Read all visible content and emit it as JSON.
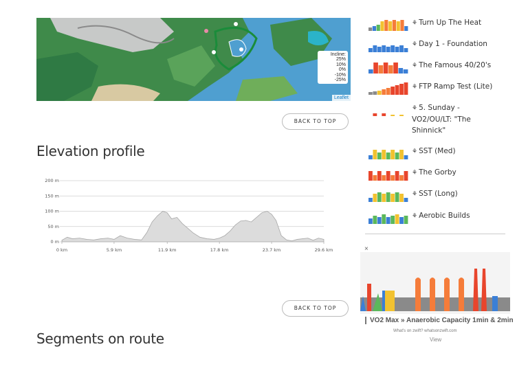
{
  "map": {
    "legend_title": "Incline:",
    "legend_values": [
      "25%",
      "10%",
      "0%",
      "-10%",
      "-25%"
    ],
    "attribution": "Leaflet"
  },
  "buttons": {
    "back_to_top": "BACK TO TOP"
  },
  "elevation": {
    "heading": "Elevation profile",
    "chart_data": {
      "type": "area",
      "x_unit": "km",
      "y_unit": "m",
      "x_ticks": [
        "0 km",
        "5.9 km",
        "11.9 km",
        "17.8 km",
        "23.7 km",
        "29.6 km"
      ],
      "y_ticks": [
        "200 m",
        "150 m",
        "100 m",
        "50 m",
        "0 m"
      ],
      "xlim": [
        0,
        29.6
      ],
      "ylim": [
        0,
        200
      ],
      "grid": true,
      "x": [
        0,
        0.6,
        1.2,
        2,
        2.8,
        3.6,
        4.4,
        5.2,
        5.9,
        6.6,
        7.4,
        8.2,
        9,
        9.6,
        10.2,
        10.8,
        11.4,
        11.9,
        12.4,
        13,
        13.6,
        14.2,
        14.8,
        15.6,
        16.4,
        17.2,
        17.8,
        18.4,
        19,
        19.6,
        20.2,
        20.8,
        21.4,
        22,
        22.6,
        23.2,
        23.7,
        24.2,
        24.8,
        25.4,
        26,
        26.6,
        27.2,
        27.8,
        28.4,
        29,
        29.6
      ],
      "y": [
        5,
        15,
        10,
        12,
        8,
        6,
        10,
        12,
        8,
        20,
        12,
        8,
        6,
        30,
        65,
        85,
        100,
        95,
        75,
        80,
        60,
        45,
        30,
        15,
        10,
        8,
        12,
        20,
        35,
        55,
        68,
        70,
        65,
        80,
        95,
        100,
        90,
        70,
        20,
        6,
        3,
        8,
        10,
        12,
        5,
        12,
        8
      ]
    }
  },
  "segments": {
    "heading": "Segments on route"
  },
  "workouts": [
    {
      "title": "Turn Up The Heat",
      "icon": "bike-icon"
    },
    {
      "title": "Day 1 - Foundation",
      "icon": "bike-icon"
    },
    {
      "title": "The Famous 40/20's",
      "icon": "bike-icon"
    },
    {
      "title": "FTP Ramp Test (Lite)",
      "icon": "bike-icon"
    },
    {
      "title": "5. Sunday - VO2/OU/LT: \"The Shinnick\"",
      "icon": "bike-icon"
    },
    {
      "title": "SST (Med)",
      "icon": "bike-icon"
    },
    {
      "title": "The Gorby",
      "icon": "bike-icon"
    },
    {
      "title": "SST (Long)",
      "icon": "bike-icon"
    },
    {
      "title": "Aerobic Builds",
      "icon": "bike-icon"
    }
  ],
  "ad": {
    "close": "×",
    "title": "VO2 Max » Anaerobic Capacity 1min & 2min",
    "subtitle": "What's on zwift? whatsonzwift.com",
    "view": "View"
  },
  "colors": {
    "zone_grey": "#8a8a8a",
    "zone_blue": "#3b7fd6",
    "zone_green": "#5bb85b",
    "zone_yellow": "#f2c230",
    "zone_orange": "#f57c3a",
    "zone_red": "#e8452c",
    "route": "#1a8c3a",
    "water": "#4f9fd0"
  }
}
